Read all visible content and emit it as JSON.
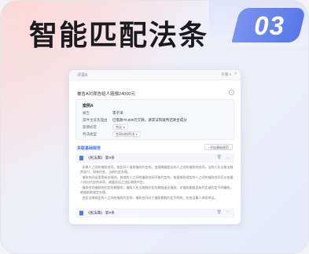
{
  "headline": "智能匹配法条",
  "badge": "03",
  "panel": {
    "tab_title": "评语A",
    "top_right": "折叠 ▾",
    "question": "被告A对原告给人赔偿24000元",
    "case": {
      "title": "案例A",
      "rows": [
        {
          "label": "被告",
          "value": "李子洋"
        },
        {
          "label": "案件主诉及理由",
          "value": "已借款70,000元欠款，请求法院裁判还款合成分"
        },
        {
          "label": "案情标签",
          "value": "合议 ∨",
          "tag": true
        },
        {
          "label": "判决类型",
          "value": "合同纠纷判决 ∨",
          "tag": true
        }
      ]
    },
    "section_title": "关联基础规范",
    "section_button": "+添加基础规范",
    "laws": [
      {
        "name": "《民法典》 第X条",
        "delete": "🗑",
        "chevron": "︿"
      },
      {
        "name": "《民法典》 第X条",
        "delete": "🗑",
        "chevron": "﹀"
      }
    ],
    "paragraphs": [
      "· 如果人之间的借款合同，依民间人借债借的约定的，违规降解超出的人之间的借款的合同，法院人应当依法裁判支付，如有约定，当依约定办理。",
      "· 借款合同适用等有关规则，其他的人之间的借款合同不能约定的，依据前款规定的人之间的借款合同可以依据人给出约定的本项，根据诉讼之违反借款约定。",
      "· 借款合同借款的约定的期限的，借款人应当按照约定的期限返还借款；对借款期限没有约定或约定不明确的，依据前款规定办理。",
      "· 违反法律规定的人之间的借款约定的，借款合同对于借款期限约定不明的，应由当事人承担举证。"
    ]
  }
}
